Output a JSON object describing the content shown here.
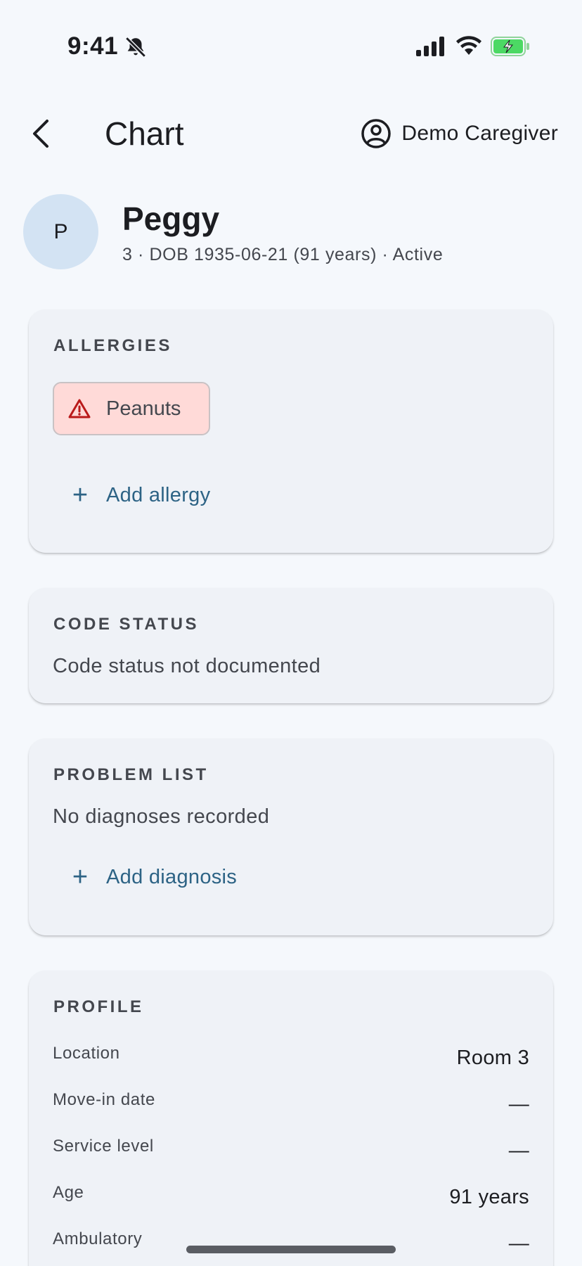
{
  "status_bar": {
    "time": "9:41",
    "icons": [
      "bell-slash-icon",
      "cellular-signal-icon",
      "wifi-icon",
      "battery-charging-icon"
    ],
    "battery_color": "#4cd964"
  },
  "app_bar": {
    "back_icon": "chevron-left-icon",
    "title": "Chart",
    "user_icon": "account-circle-icon",
    "user_name": "Demo Caregiver"
  },
  "patient": {
    "avatar_initial": "P",
    "name": "Peggy",
    "meta": "3 · DOB 1935-06-21 (91 years) · Active"
  },
  "allergies": {
    "title": "ALLERGIES",
    "items": [
      {
        "label": "Peanuts",
        "icon": "warning-triangle-icon"
      }
    ],
    "add_label": "Add allergy"
  },
  "code_status": {
    "title": "CODE STATUS",
    "text": "Code status not documented"
  },
  "problem_list": {
    "title": "PROBLEM LIST",
    "empty_text": "No diagnoses recorded",
    "add_label": "Add diagnosis"
  },
  "profile": {
    "title": "PROFILE",
    "rows": [
      {
        "label": "Location",
        "value": "Room 3"
      },
      {
        "label": "Move-in date",
        "value": "—"
      },
      {
        "label": "Service level",
        "value": "—"
      },
      {
        "label": "Age",
        "value": "91 years"
      },
      {
        "label": "Ambulatory",
        "value": "—"
      }
    ]
  },
  "colors": {
    "background": "#f5f8fc",
    "card": "#eff2f7",
    "accent": "#2d6385",
    "allergy_bg": "#ffdad8",
    "allergy_icon": "#ba1a1a",
    "avatar_bg": "#d3e3f3"
  }
}
